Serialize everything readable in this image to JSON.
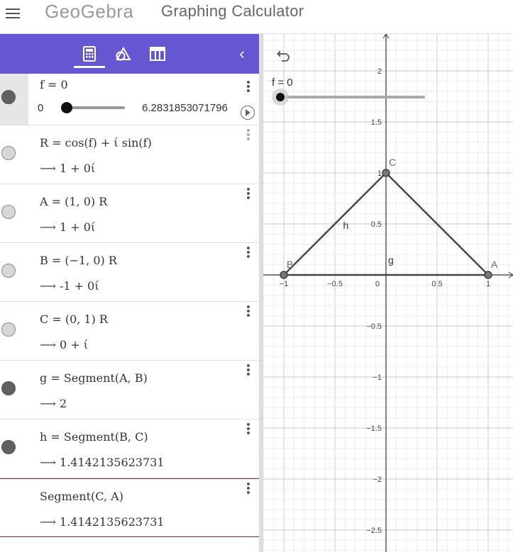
{
  "header": {
    "logo": "GeoGebra",
    "app_title": "Graphing Calculator"
  },
  "toolbar": {
    "tabs": [
      {
        "icon": "calculator-icon",
        "active": true
      },
      {
        "icon": "geometry-icon",
        "active": false
      },
      {
        "icon": "table-icon",
        "active": false
      }
    ],
    "collapse_label": "‹"
  },
  "algebra": {
    "slider": {
      "definition": "f = 0",
      "min": "0",
      "max": "6.2831853071796",
      "value_fraction": 0
    },
    "rows": [
      {
        "definition": "R = cos(f) + ί sin(f)",
        "value": "1 + 0ί",
        "visible": false
      },
      {
        "definition": "A = (1, 0) R",
        "value": "1 + 0ί",
        "visible": false
      },
      {
        "definition": "B = (−1, 0) R",
        "value": "-1 + 0ί",
        "visible": false
      },
      {
        "definition": "C = (0, 1) R",
        "value": "0 + ί",
        "visible": false
      },
      {
        "definition": "g = Segment(A, B)",
        "value": "2",
        "visible": true
      },
      {
        "definition": "h = Segment(B, C)",
        "value": "1.4142135623731",
        "visible": true
      },
      {
        "definition": "Segment(C, A)",
        "value": "1.4142135623731",
        "visible": null
      }
    ]
  },
  "graphics": {
    "slider_label": "f = 0",
    "x_ticks": [
      "−1",
      "−0.5",
      "0",
      "0.5",
      "1"
    ],
    "y_ticks": [
      "2",
      "1.5",
      "1",
      "0.5",
      "−0.5",
      "−1",
      "−1.5",
      "−2",
      "−2.5"
    ],
    "points": [
      {
        "label": "A",
        "x": 1,
        "y": 0
      },
      {
        "label": "B",
        "x": -1,
        "y": 0
      },
      {
        "label": "C",
        "x": 0,
        "y": 1
      }
    ],
    "segment_labels": [
      {
        "label": "g"
      },
      {
        "label": "h"
      }
    ]
  }
}
